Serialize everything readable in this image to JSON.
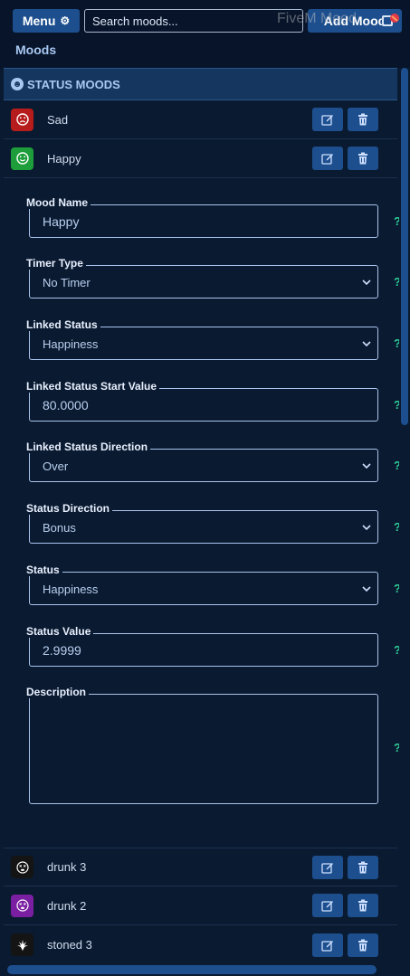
{
  "header": {
    "menu_label": "Menu",
    "search_placeholder": "Search moods...",
    "add_label": "Add Mood",
    "watermark": "FiveM Mood",
    "section_title": "Moods"
  },
  "category": {
    "label": "STATUS MOODS"
  },
  "moods": [
    {
      "name": "Sad",
      "icon": "sad-face-icon",
      "color": "#b71c1c"
    },
    {
      "name": "Happy",
      "icon": "happy-face-icon",
      "color": "#1e9e3a"
    },
    {
      "name": "drunk 3",
      "icon": "dizzy-face-icon",
      "color": "#141414"
    },
    {
      "name": "drunk 2",
      "icon": "dizzy-face-icon",
      "color": "#7b1fa2"
    },
    {
      "name": "stoned 3",
      "icon": "cannabis-leaf-icon",
      "color": "#141414"
    }
  ],
  "form": {
    "mood_name": {
      "label": "Mood Name",
      "value": "Happy"
    },
    "timer_type": {
      "label": "Timer Type",
      "value": "No Timer"
    },
    "linked_status": {
      "label": "Linked Status",
      "value": "Happiness"
    },
    "linked_start": {
      "label": "Linked Status Start Value",
      "value": "80.0000"
    },
    "linked_direction": {
      "label": "Linked Status Direction",
      "value": "Over"
    },
    "status_direction": {
      "label": "Status Direction",
      "value": "Bonus"
    },
    "status": {
      "label": "Status",
      "value": "Happiness"
    },
    "status_value": {
      "label": "Status Value",
      "value": "2.9999"
    },
    "description": {
      "label": "Description",
      "value": ""
    },
    "help_glyph": "?"
  },
  "colors": {
    "panel_bg": "#0a1a30",
    "button_bg": "#1d4f8e",
    "help_color": "#2fcf9a"
  }
}
